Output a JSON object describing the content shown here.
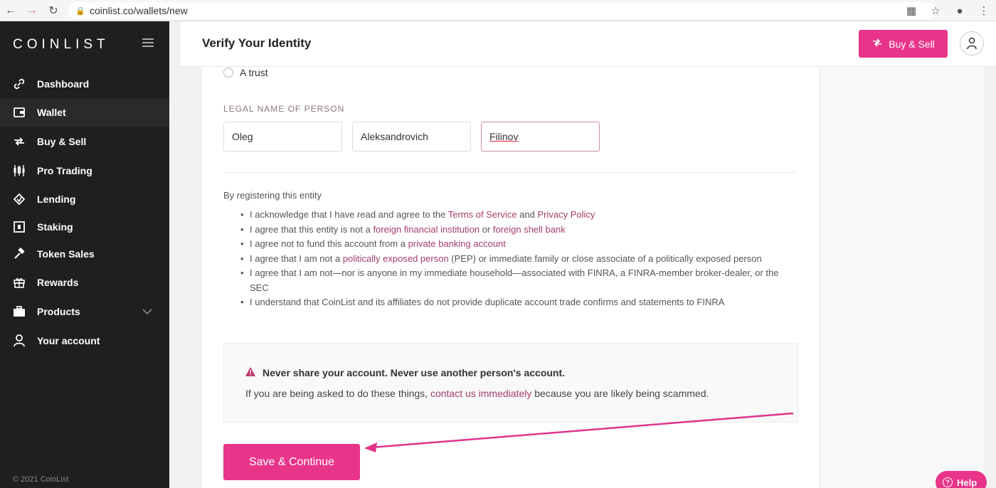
{
  "browser": {
    "url": "coinlist.co/wallets/new"
  },
  "sidebar": {
    "logo": "COINLIST",
    "items": [
      {
        "label": "Dashboard",
        "icon": "link-icon"
      },
      {
        "label": "Wallet",
        "icon": "wallet-icon"
      },
      {
        "label": "Buy & Sell",
        "icon": "transfer-icon"
      },
      {
        "label": "Pro Trading",
        "icon": "candlestick-icon"
      },
      {
        "label": "Lending",
        "icon": "lending-icon"
      },
      {
        "label": "Staking",
        "icon": "staking-icon"
      },
      {
        "label": "Token Sales",
        "icon": "hammer-icon"
      },
      {
        "label": "Rewards",
        "icon": "gift-icon"
      },
      {
        "label": "Products",
        "icon": "briefcase-icon"
      },
      {
        "label": "Your account",
        "icon": "user-icon"
      }
    ],
    "active_item": "Wallet",
    "copyright": "© 2021 CoinList"
  },
  "header": {
    "title": "Verify Your Identity",
    "buy_sell_label": "Buy & Sell"
  },
  "form": {
    "radio_option": "A trust",
    "legal_name_label": "LEGAL NAME OF PERSON",
    "first_name": "Oleg",
    "middle_name": "Aleksandrovich",
    "last_name": "Filinov"
  },
  "terms": {
    "intro": "By registering this entity",
    "items": [
      {
        "parts": [
          "I acknowledge that I have read and agree to the ",
          "Terms of Service",
          " and ",
          "Privacy Policy",
          ""
        ]
      },
      {
        "parts": [
          "I agree that this entity is not a ",
          "foreign financial institution",
          " or ",
          "foreign shell bank",
          ""
        ]
      },
      {
        "parts": [
          "I agree not to fund this account from a ",
          "private banking account",
          "",
          "",
          ""
        ]
      },
      {
        "parts": [
          "I agree that I am not a ",
          "politically exposed person",
          " (PEP) or immediate family or close associate of a politically exposed person",
          "",
          ""
        ]
      },
      {
        "parts": [
          "I agree that I am not—nor is anyone in my immediate household—associated with FINRA, a FINRA-member broker-dealer, or the SEC",
          "",
          "",
          "",
          ""
        ]
      },
      {
        "parts": [
          "I understand that CoinList and its affiliates do not provide duplicate account trade confirms and statements to FINRA",
          "",
          "",
          "",
          ""
        ]
      }
    ]
  },
  "warning": {
    "title": "Never share your account. Never use another person's account.",
    "text_before": "If you are being asked to do these things, ",
    "link": "contact us immediately",
    "text_after": " because you are likely being scammed."
  },
  "actions": {
    "save_label": "Save & Continue"
  },
  "help": {
    "label": "Help"
  },
  "colors": {
    "accent": "#e8358a",
    "link": "#a23d6c",
    "sidebar_bg": "#1f1f21"
  }
}
